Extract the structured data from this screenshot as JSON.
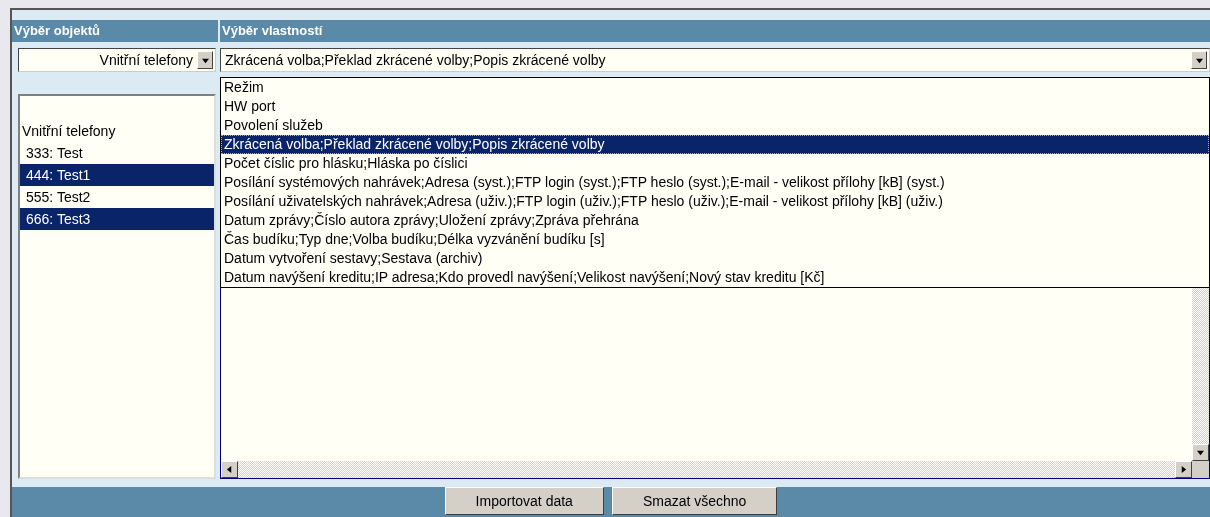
{
  "headers": [
    "Výběr objektů",
    "Výběr vlastností"
  ],
  "object_select": {
    "value": "Vnitřní telefony"
  },
  "property_select": {
    "value": "Zkrácená volba;Překlad zkrácené volby;Popis zkrácené volby",
    "expanded": true
  },
  "object_list": {
    "group": "Vnitřní telefony",
    "items": [
      {
        "label": "333: Test",
        "selected": false
      },
      {
        "label": "444: Test1",
        "selected": true
      },
      {
        "label": "555: Test2",
        "selected": false
      },
      {
        "label": "666: Test3",
        "selected": true
      }
    ]
  },
  "property_options": [
    {
      "label": "Režim",
      "selected": false
    },
    {
      "label": "HW port",
      "selected": false
    },
    {
      "label": "Povolení služeb",
      "selected": false
    },
    {
      "label": "Zkrácená volba;Překlad zkrácené volby;Popis zkrácené volby",
      "selected": true
    },
    {
      "label": "Počet číslic pro hlásku;Hláska po číslici",
      "selected": false
    },
    {
      "label": "Posílání systémových nahrávek;Adresa (syst.);FTP login (syst.);FTP heslo (syst.);E-mail - velikost přílohy [kB] (syst.)",
      "selected": false
    },
    {
      "label": "Posílání uživatelských nahrávek;Adresa (uživ.);FTP login (uživ.);FTP heslo (uživ.);E-mail - velikost přílohy [kB] (uživ.)",
      "selected": false
    },
    {
      "label": "Datum zprávy;Číslo autora zprávy;Uložení zprávy;Zpráva přehrána",
      "selected": false
    },
    {
      "label": "Čas budíku;Typ dne;Volba budíku;Délka vyzvánění budíku [s]",
      "selected": false
    },
    {
      "label": "Datum vytvoření sestavy;Sestava (archiv)",
      "selected": false
    },
    {
      "label": "Datum navýšení kreditu;IP adresa;Kdo provedl navýšení;Velikost navýšení;Nový stav kreditu [Kč]",
      "selected": false
    }
  ],
  "buttons": [
    "Importovat data",
    "Smazat všechno"
  ]
}
